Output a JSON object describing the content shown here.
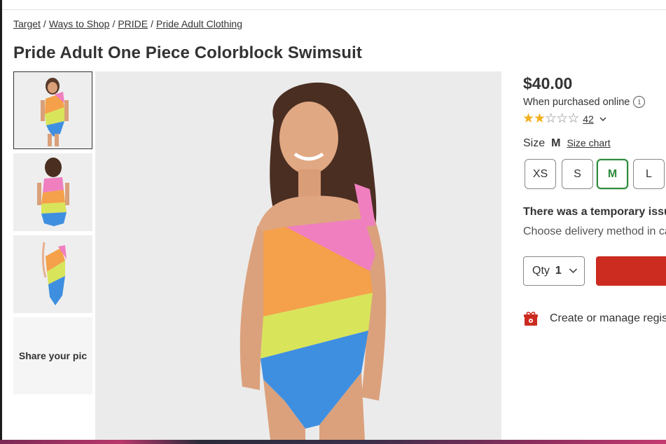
{
  "breadcrumb": [
    {
      "label": "Target"
    },
    {
      "label": "Ways to Shop"
    },
    {
      "label": "PRIDE"
    },
    {
      "label": "Pride Adult Clothing"
    }
  ],
  "product": {
    "title": "Pride Adult One Piece Colorblock Swimsuit",
    "price": "$40.00",
    "price_note": "When purchased online",
    "rating": 2,
    "rating_max": 5,
    "review_count": "42"
  },
  "thumbnails": {
    "share_label": "Share your pic"
  },
  "size": {
    "label": "Size",
    "selected": "M",
    "chart_link": "Size chart",
    "options": [
      "XS",
      "S",
      "M",
      "L"
    ]
  },
  "messages": {
    "issue": "There was a temporary issu",
    "delivery": "Choose delivery method in ca"
  },
  "quantity": {
    "label": "Qty",
    "value": "1"
  },
  "registry": {
    "label": "Create or manage regis"
  },
  "colors": {
    "accent_red": "#cc2b1f",
    "selected_green": "#2d8a3a",
    "star_gold": "#f2b01e",
    "swim_pink": "#f07fc0",
    "swim_orange": "#f5a04a",
    "swim_yellow": "#d8e45a",
    "swim_blue": "#3f8fe0"
  }
}
